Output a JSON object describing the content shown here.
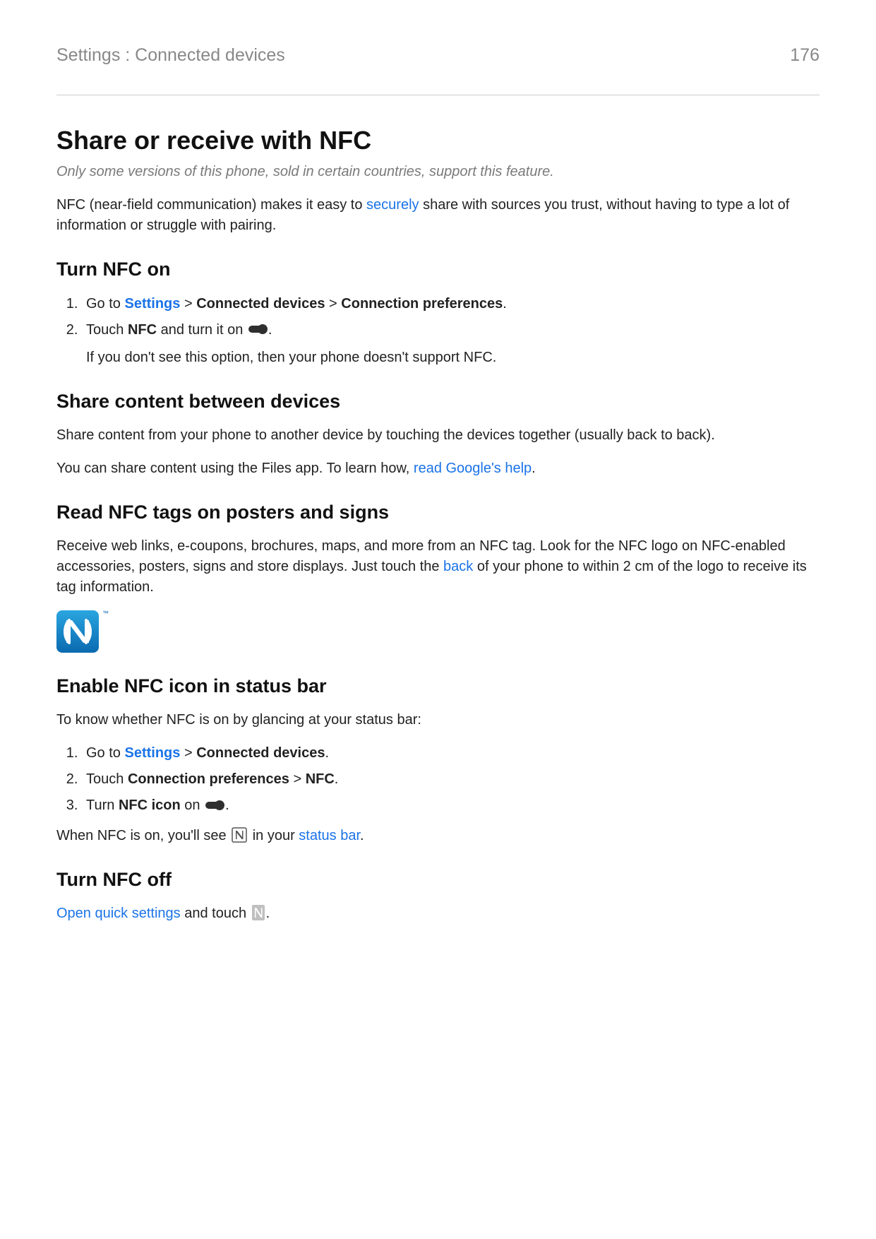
{
  "header": {
    "breadcrumb": "Settings : Connected devices",
    "page_number": "176"
  },
  "title": "Share or receive with NFC",
  "subtitle_italic": "Only some versions of this phone, sold in certain countries, support this feature.",
  "intro": {
    "pre": "NFC (near-field communication) makes it easy to ",
    "link": "securely",
    "post": " share with sources you trust, without having to type a lot of information or struggle with pairing."
  },
  "section_turn_on": {
    "heading": "Turn NFC on",
    "step1": {
      "goto": "Go to ",
      "settings": "Settings",
      "sep1": " > ",
      "b1": "Connected devices",
      "sep2": " > ",
      "b2": "Connection preferences",
      "dot": "."
    },
    "step2": {
      "pre": "Touch ",
      "bold": "NFC",
      "mid": " and turn it on ",
      "dot": ".",
      "sub": "If you don't see this option, then your phone doesn't support NFC."
    }
  },
  "section_share": {
    "heading": "Share content between devices",
    "p1": "Share content from your phone to another device by touching the devices together (usually back to back).",
    "p2_pre": "You can share content using the Files app. To learn how, ",
    "p2_link": "read Google's help",
    "p2_post": "."
  },
  "section_read": {
    "heading": "Read NFC tags on posters and signs",
    "p_pre": "Receive web links, e-coupons, brochures, maps, and more from an NFC tag. Look for the NFC logo on NFC-enabled accessories, posters, signs and store displays. Just touch the ",
    "p_link": "back",
    "p_post": " of your phone to within 2 cm of the logo to receive its tag information."
  },
  "section_enable_icon": {
    "heading": "Enable NFC icon in status bar",
    "intro": "To know whether NFC is on by glancing at your status bar:",
    "step1": {
      "goto": "Go to ",
      "settings": "Settings",
      "sep1": " > ",
      "b1": "Connected devices",
      "dot": "."
    },
    "step2": {
      "pre": "Touch ",
      "b1": "Connection preferences",
      "sep": " > ",
      "b2": "NFC",
      "dot": "."
    },
    "step3": {
      "pre": "Turn ",
      "bold": "NFC icon",
      "mid": " on ",
      "dot": "."
    },
    "footer": {
      "pre": "When NFC is on, you'll see ",
      "mid": " in your ",
      "link": "status bar",
      "dot": "."
    }
  },
  "section_turn_off": {
    "heading": "Turn NFC off",
    "p_link": "Open quick settings",
    "p_mid": " and touch ",
    "p_dot": "."
  }
}
